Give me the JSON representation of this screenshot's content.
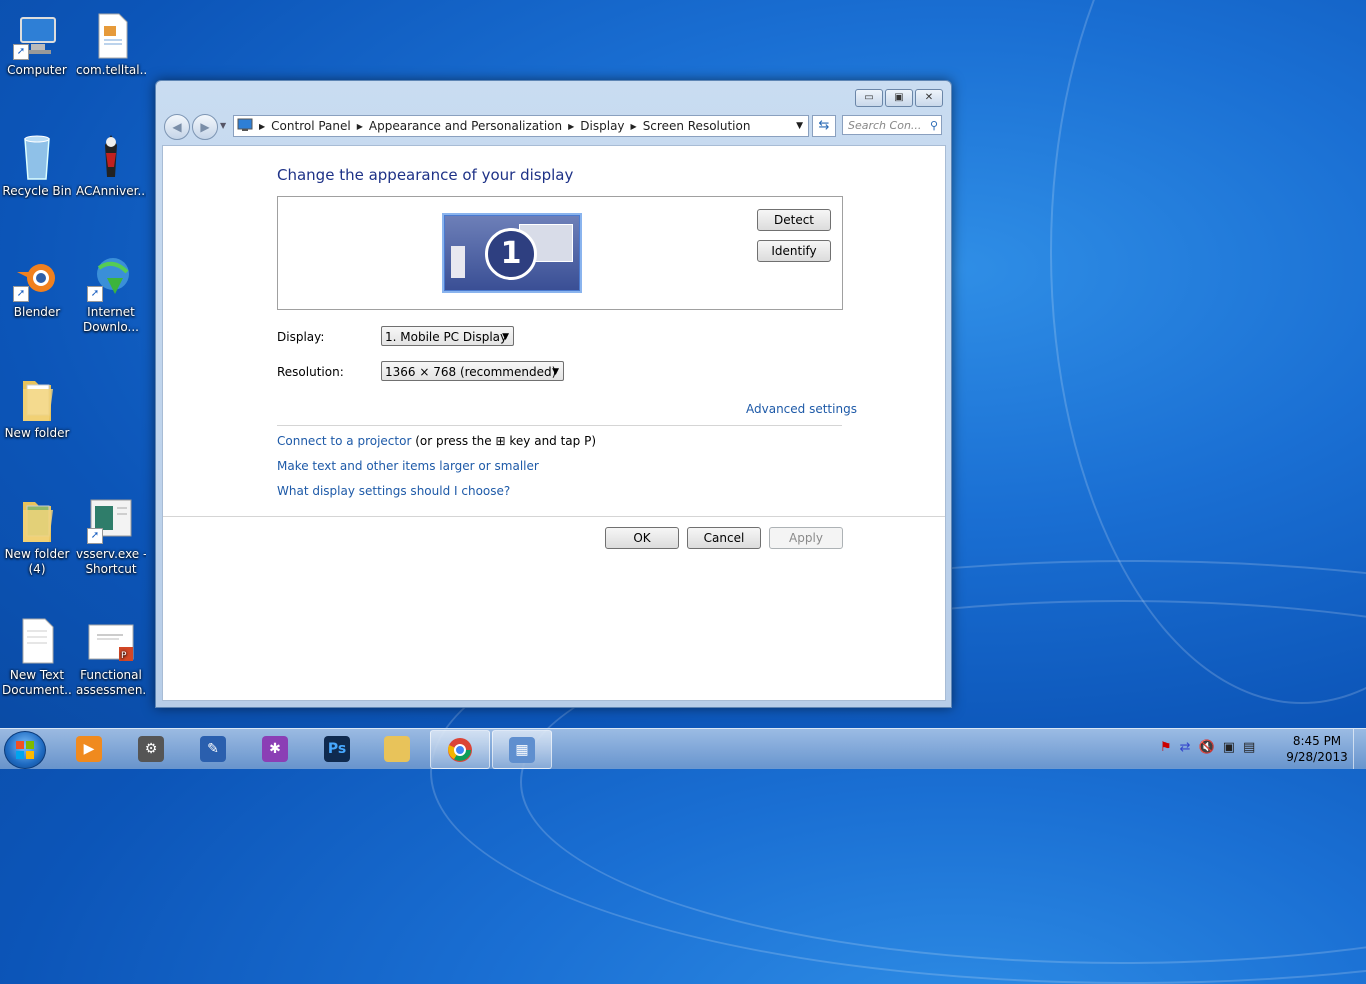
{
  "desktop": {
    "icons": [
      {
        "label": "Computer",
        "icon": "computer-icon"
      },
      {
        "label": "com.telltal...",
        "icon": "document-icon"
      },
      {
        "label": "Recycle Bin",
        "icon": "recycle-bin-icon"
      },
      {
        "label": "ACAnniver...",
        "icon": "game-icon"
      },
      {
        "label": "Blender",
        "icon": "blender-icon"
      },
      {
        "label": "Internet",
        "label2": "Downlo...",
        "icon": "download-manager-icon"
      },
      {
        "label": "New folder",
        "icon": "folder-icon"
      },
      {
        "label": "New folder",
        "label2": "(4)",
        "icon": "folder-icon"
      },
      {
        "label": "vsserv.exe -",
        "label2": "Shortcut",
        "icon": "app-icon"
      },
      {
        "label": "New Text",
        "label2": "Document....",
        "icon": "text-file-icon"
      },
      {
        "label": "Functional",
        "label2": "assessmen...",
        "icon": "powerpoint-file-icon"
      }
    ]
  },
  "window": {
    "controls": {
      "minimize": "▭",
      "maximize": "▣",
      "close": "✕"
    },
    "breadcrumb": [
      "Control Panel",
      "Appearance and Personalization",
      "Display",
      "Screen Resolution"
    ],
    "search_placeholder": "Search Con...",
    "heading": "Change the appearance of your display",
    "monitor_number": "1",
    "detect_label": "Detect",
    "identify_label": "Identify",
    "display_label": "Display:",
    "display_value": "1. Mobile PC Display",
    "resolution_label": "Resolution:",
    "resolution_value": "1366 × 768 (recommended)",
    "advanced_link": "Advanced settings",
    "projector_link": "Connect to a projector",
    "projector_text_before": "(or press the",
    "projector_text_after": "key and tap P)",
    "larger_link": "Make text and other items larger or smaller",
    "help_link": "What display settings should I choose?",
    "ok_label": "OK",
    "cancel_label": "Cancel",
    "apply_label": "Apply"
  },
  "taskbar": {
    "pinned": [
      "media-player-icon",
      "scanner-icon",
      "pen-app-icon",
      "spider-app-icon",
      "photoshop-icon",
      "folder-icon",
      "chrome-icon",
      "display-settings-icon"
    ],
    "photoshop_text": "Ps",
    "clock_time": "8:45 PM",
    "clock_date": "9/28/2013"
  },
  "colors": {
    "accent_blue": "#1e5aa8",
    "heading_blue": "#1e3287",
    "desktop_blue": "#1a6fd3"
  }
}
